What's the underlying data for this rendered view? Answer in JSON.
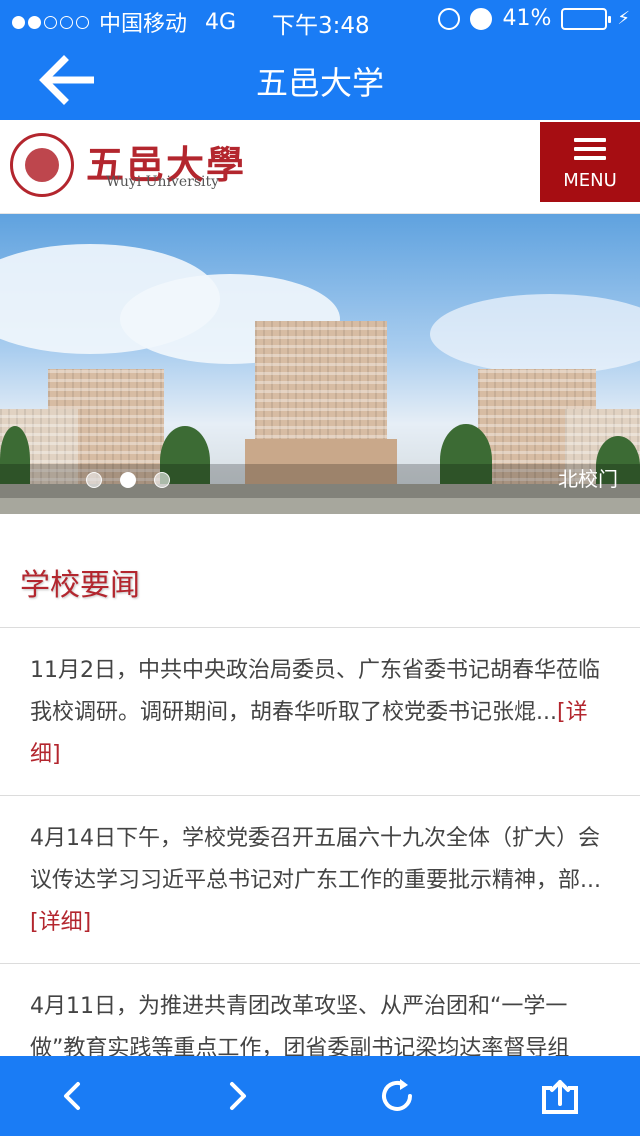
{
  "status_bar": {
    "carrier": "中国移动",
    "network": "4G",
    "time": "下午3:48",
    "battery": "41%",
    "battery_level": 0.41
  },
  "nav": {
    "title": "五邑大学",
    "back_icon": "arrow-left-icon"
  },
  "site_header": {
    "logo_cn": "五邑大學",
    "logo_en": "Wuyi University",
    "menu_label": "MENU",
    "menu_icon": "hamburger-icon",
    "brand_color": "#b3262e"
  },
  "banner": {
    "caption": "北校门",
    "slide_count": 3,
    "active_slide": 2
  },
  "section": {
    "title": "学校要闻"
  },
  "news": [
    {
      "text": "11月2日，中共中央政治局委员、广东省委书记胡春华莅临我校调研。调研期间，胡春华听取了校党委书记张焜...",
      "more": "[详细]"
    },
    {
      "text": "4月14日下午，学校党委召开五届六十九次全体（扩大）会议传达学习习近平总书记对广东工作的重要批示精神，部...",
      "more": "[详细]"
    },
    {
      "text": "4月11日，为推进共青团改革攻坚、从严治团和“一学一做”教育实践等重点工作，团省委副书记梁均达率督导组",
      "more": ""
    }
  ],
  "toolbar": {
    "items": [
      "chevron-left-icon",
      "chevron-right-icon",
      "refresh-icon",
      "share-icon"
    ],
    "color": "#1a7cf5"
  }
}
